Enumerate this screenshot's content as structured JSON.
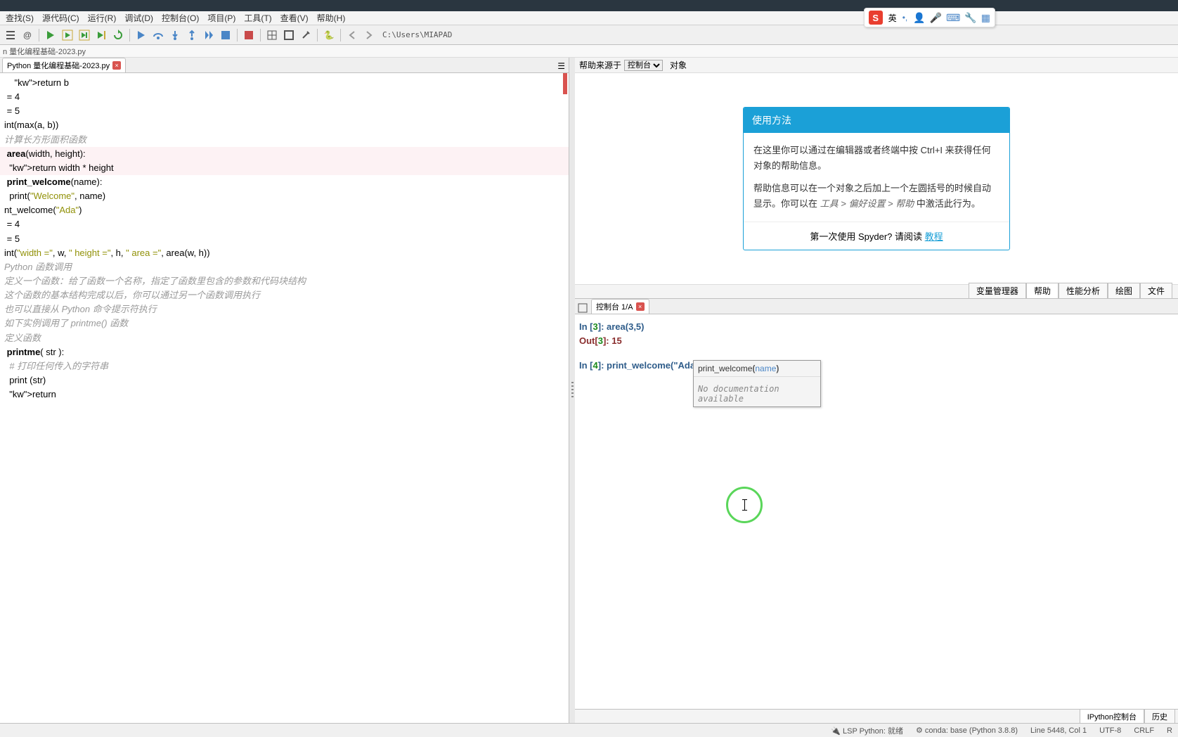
{
  "menu": {
    "find": "查找(S)",
    "source": "源代码(C)",
    "run": "运行(R)",
    "debug": "调试(D)",
    "console": "控制台(O)",
    "project": "项目(P)",
    "tools": "工具(T)",
    "view": "查看(V)",
    "help": "帮助(H)"
  },
  "path": "C:\\Users\\MIAPAD",
  "breadcrumb": "n 量化编程基础-2023.py",
  "tab_name": "Python 量化编程基础-2023.py",
  "editor_lines": [
    {
      "t": "    return b"
    },
    {
      "t": ""
    },
    {
      "t": ""
    },
    {
      "t": " = 4"
    },
    {
      "t": " = 5"
    },
    {
      "t": "int(max(a, b))"
    },
    {
      "t": ""
    },
    {
      "t": ""
    },
    {
      "t": "计算长方形面积函数",
      "cls": "comment"
    },
    {
      "t": " area(width, height):",
      "hl": true,
      "fn": "area",
      "kw": ""
    },
    {
      "t": "  return width * height",
      "hl": true
    },
    {
      "t": ""
    },
    {
      "t": ""
    },
    {
      "t": " print_welcome(name):",
      "fn": "print_welcome"
    },
    {
      "t": "  print(\"Welcome\", name)"
    },
    {
      "t": ""
    },
    {
      "t": "nt_welcome(\"Ada\")"
    },
    {
      "t": ""
    },
    {
      "t": " = 4"
    },
    {
      "t": " = 5"
    },
    {
      "t": "int(\"width =\", w, \" height =\", h, \" area =\", area(w, h))"
    },
    {
      "t": ""
    },
    {
      "t": ""
    },
    {
      "t": ""
    },
    {
      "t": "Python 函数调用",
      "cls": "comment"
    },
    {
      "t": ""
    },
    {
      "t": "定义一个函数：给了函数一个名称，指定了函数里包含的参数和代码块结构",
      "cls": "comment"
    },
    {
      "t": ""
    },
    {
      "t": ""
    },
    {
      "t": "这个函数的基本结构完成以后，你可以通过另一个函数调用执行",
      "cls": "comment"
    },
    {
      "t": ""
    },
    {
      "t": "也可以直接从 Python 命令提示符执行",
      "cls": "comment"
    },
    {
      "t": ""
    },
    {
      "t": "如下实例调用了 printme() 函数",
      "cls": "comment"
    },
    {
      "t": ""
    },
    {
      "t": ""
    },
    {
      "t": ""
    },
    {
      "t": "定义函数",
      "cls": "comment"
    },
    {
      "t": " printme( str ):",
      "fn": "printme"
    },
    {
      "t": "  # 打印任何传入的字符串",
      "cls": "comment"
    },
    {
      "t": "  print (str)"
    },
    {
      "t": "  return"
    },
    {
      "t": ""
    }
  ],
  "help": {
    "source_label": "帮助来源于",
    "source_value": "控制台",
    "object_label": "对象",
    "card_title": "使用方法",
    "body1": "在这里你可以通过在编辑器或者终端中按 Ctrl+I 来获得任何对象的帮助信息。",
    "body2_a": "帮助信息可以在一个对象之后加上一个左圆括号的时候自动显示。你可以在 ",
    "body2_b": "工具 > 偏好设置 > 帮助",
    "body2_c": " 中激活此行为。",
    "footer_a": "第一次使用 Spyder? 请阅读 ",
    "footer_b": "教程"
  },
  "help_tabs": {
    "var": "变量管理器",
    "help": "帮助",
    "perf": "性能分析",
    "plot": "绘图",
    "file": "文件"
  },
  "console": {
    "tab": "控制台 1/A",
    "in3": "In [",
    "in3n": "3",
    "in3b": "]: area(3,5)",
    "out3": "Out[",
    "out3n": "3",
    "out3b": "]: 15",
    "in4": "In [",
    "in4n": "4",
    "in4b": "]: print_welcome(\"Ada",
    "tooltip_fn": "print_welcome",
    "tooltip_param": "name",
    "tooltip_doc": "No documentation available"
  },
  "bottom_tabs": {
    "ipy": "IPython控制台",
    "hist": "历史"
  },
  "status": {
    "lsp": "LSP Python: 就绪",
    "conda": "conda: base (Python 3.8.8)",
    "line": "Line 5448, Col 1",
    "enc": "UTF-8",
    "eol": "CRLF",
    "rw": "R"
  },
  "ime": {
    "lang": "英"
  }
}
